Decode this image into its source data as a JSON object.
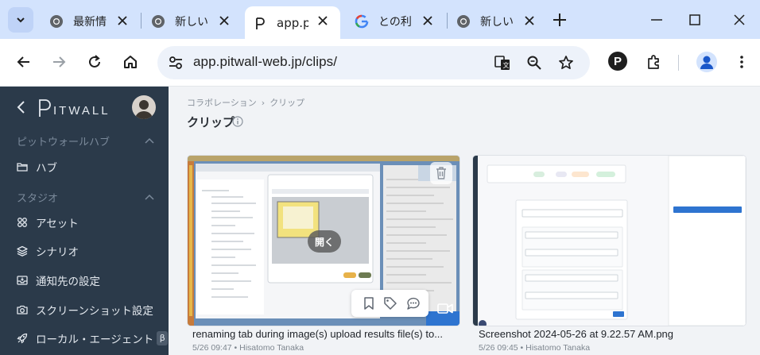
{
  "browser": {
    "tabs": [
      {
        "title": "最新情報",
        "icon": "chrome-icon"
      },
      {
        "title": "新しいタブ",
        "icon": "chrome-icon"
      },
      {
        "title": "app.pitwall-web.jp",
        "icon": "pitwall-p-icon",
        "active": true
      },
      {
        "title": "との利用",
        "icon": "google-g-icon"
      },
      {
        "title": "新しいタブ",
        "icon": "chrome-icon"
      }
    ],
    "url": "app.pitwall-web.jp/clips/",
    "profile_letter": "P"
  },
  "sidebar": {
    "logo": "PITWALL",
    "sections": [
      {
        "label": "ピットウォールハブ",
        "items": [
          {
            "label": "ハブ",
            "icon": "folder-icon"
          }
        ]
      },
      {
        "label": "スタジオ",
        "items": [
          {
            "label": "アセット",
            "icon": "grid-icon"
          },
          {
            "label": "シナリオ",
            "icon": "layers-icon"
          },
          {
            "label": "通知先の設定",
            "icon": "inbox-icon"
          },
          {
            "label": "スクリーンショット設定",
            "icon": "camera-icon"
          },
          {
            "label": "ローカル・エージェント",
            "icon": "rocket-icon",
            "badge": "β"
          }
        ]
      }
    ]
  },
  "main": {
    "breadcrumb": [
      "コラボレーション",
      "クリップ"
    ],
    "title": "クリップ",
    "clips": [
      {
        "title": "renaming tab during image(s) upload results file(s) to...",
        "meta": "5/26 09:47 • Hisatomo Tanaka",
        "open_label": "開く"
      },
      {
        "title": "Screenshot 2024-05-26 at 9.22.57 AM.png",
        "meta": "5/26 09:45 • Hisatomo Tanaka"
      }
    ]
  },
  "colors": {
    "sidebar_bg": "#2b3a4a",
    "tabstrip_bg": "#d3e3fd",
    "accent": "#1a73e8"
  }
}
